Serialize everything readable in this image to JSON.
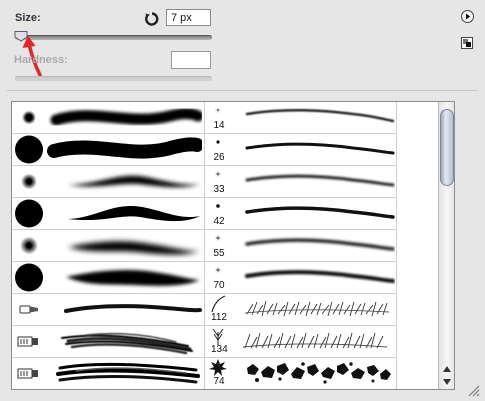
{
  "size": {
    "label": "Size:",
    "value": "7 px",
    "slider_fraction": 0.02
  },
  "hardness": {
    "label": "Hardness:",
    "value": ""
  },
  "icons": {
    "reset": "reset-rotate-icon",
    "flyout": "flyout-menu-icon",
    "new_preset": "new-preset-icon",
    "annotation": "red-arrow-annotation"
  },
  "colors": {
    "annotation": "#e0282a",
    "panel": "#e6e6e6"
  },
  "presets": {
    "small_brush_sizes": [
      "14",
      "26",
      "33",
      "42",
      "55",
      "70",
      "112",
      "134",
      "74"
    ]
  }
}
